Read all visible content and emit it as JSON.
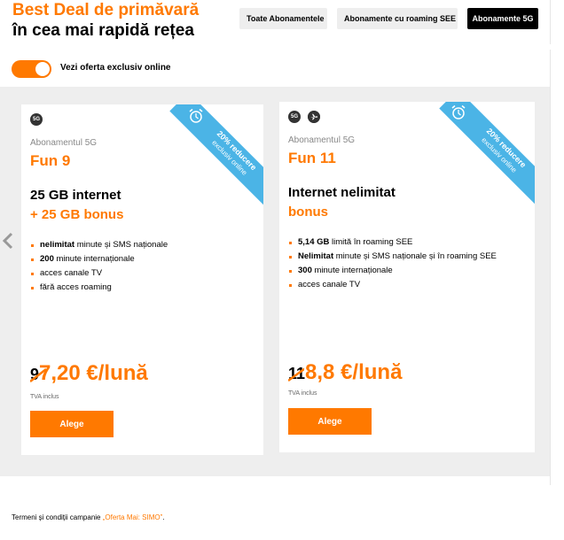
{
  "header": {
    "title_line1": "Best Deal de primăvară",
    "title_line2": "în cea mai rapidă rețea"
  },
  "filters": [
    {
      "label": "Toate Abonamentele",
      "active": false
    },
    {
      "label": "Abonamente cu roaming SEE",
      "active": false
    },
    {
      "label": "Abonamente 5G",
      "active": true
    }
  ],
  "toggle": {
    "label": "Vezi oferta exclusiv online",
    "on": true
  },
  "cards": [
    {
      "badges": [
        "5G"
      ],
      "ribbon_line1": "20% reducere",
      "ribbon_line2": "exclusiv online",
      "plan_label": "Abonamentul 5G",
      "plan_name": "Fun 9",
      "main_line1": "25 GB internet",
      "main_line2": "+ 25 GB bonus",
      "features": [
        {
          "bold": "nelimitat",
          "text": " minute și SMS naționale"
        },
        {
          "bold": "200",
          "text": " minute internaționale"
        },
        {
          "bold": "",
          "text": "acces canale TV"
        },
        {
          "bold": "",
          "text": "fără acces roaming"
        }
      ],
      "old_price": "9",
      "new_price": "7,20 €/lună",
      "tva": "TVA inclus",
      "button": "Alege"
    },
    {
      "badges": [
        "5G",
        "plane-icon"
      ],
      "ribbon_line1": "20% reducere",
      "ribbon_line2": "exclusiv online",
      "plan_label": "Abonamentul 5G",
      "plan_name": "Fun 11",
      "main_line1": "Internet nelimitat",
      "main_line2": "bonus",
      "features": [
        {
          "bold": "5,14 GB",
          "text": " limită în roaming SEE"
        },
        {
          "bold": "Nelimitat",
          "text": " minute și SMS naționale și în roaming SEE"
        },
        {
          "bold": "300",
          "text": " minute internaționale"
        },
        {
          "bold": "",
          "text": "acces canale TV"
        }
      ],
      "old_price": "11",
      "new_price": "8,8 €/lună",
      "tva": "TVA inclus",
      "button": "Alege"
    }
  ],
  "footer": {
    "prefix": "Termeni și condiții campanie ",
    "link": "„Oferta Mai: SIMO”",
    "suffix": "."
  },
  "colors": {
    "accent": "#ff7900",
    "ribbon": "#4bb4e6",
    "band": "#eeeeee"
  }
}
